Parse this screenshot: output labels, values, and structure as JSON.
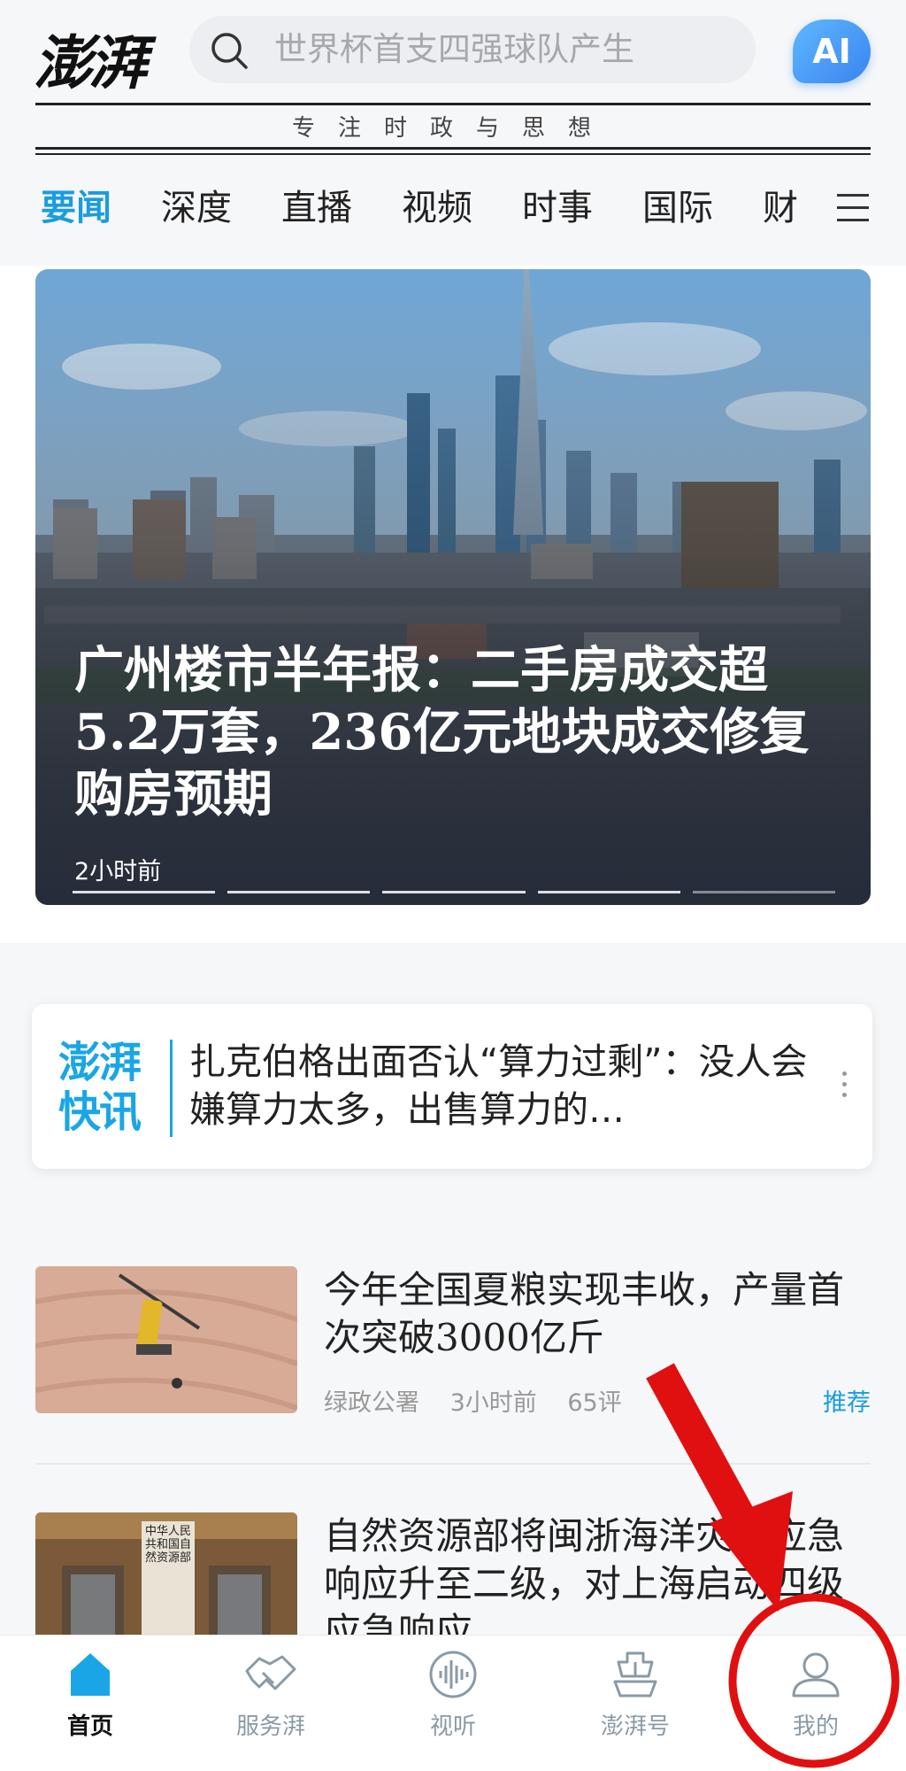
{
  "header": {
    "logo": "澎湃",
    "search_placeholder": "世界杯首支四强球队产生",
    "ai_label": "AI",
    "slogan": "专注时政与思想"
  },
  "tabs": [
    "要闻",
    "深度",
    "直播",
    "视频",
    "时事",
    "国际",
    "财"
  ],
  "hero": {
    "title": "广州楼市半年报：二手房成交超5.2万套，236亿元地块成交修复购房预期",
    "time": "2小时前",
    "slide_count": 5,
    "active_slide": 1
  },
  "quick_news": {
    "logo_line1": "澎湃",
    "logo_line2": "快讯",
    "text": "扎克伯格出面否认“算力过剩”：没人会嫌算力太多，出售算力的…"
  },
  "news": [
    {
      "title": "今年全国夏粮实现丰收，产量首次突破3000亿斤",
      "source": "绿政公署",
      "time": "3小时前",
      "comments": "65评",
      "tag": "推荐"
    },
    {
      "title": "自然资源部将闽浙海洋灾害应急响应升至二级，对上海启动四级应急响应",
      "thumb_sign": "中华人民共和国自然资源部"
    }
  ],
  "bottom_nav": [
    {
      "label": "首页",
      "icon": "home-icon",
      "active": true
    },
    {
      "label": "服务湃",
      "icon": "handshake-icon",
      "active": false
    },
    {
      "label": "视听",
      "icon": "audio-wave-icon",
      "active": false
    },
    {
      "label": "澎湃号",
      "icon": "ship-icon",
      "active": false
    },
    {
      "label": "我的",
      "icon": "user-icon",
      "active": false
    }
  ],
  "colors": {
    "accent": "#1a9ce0",
    "annotation": "#e01010"
  }
}
